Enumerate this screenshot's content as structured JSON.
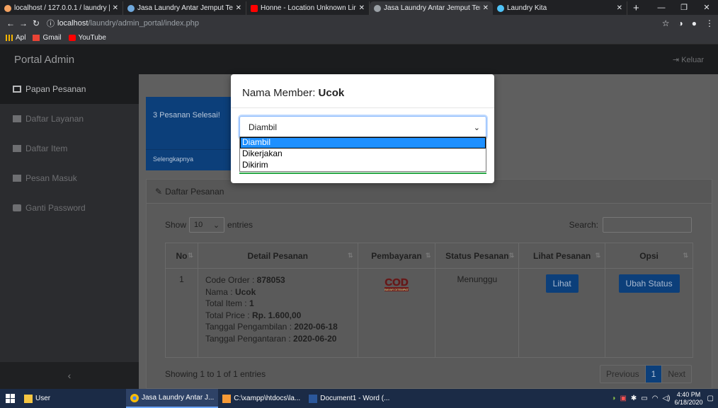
{
  "browser": {
    "tabs": [
      {
        "title": "localhost / 127.0.0.1 / laundry |",
        "icon": "phpmyadmin-icon",
        "color": "#f4a261"
      },
      {
        "title": "Jasa Laundry Antar Jemput Ter",
        "icon": "laundry-icon",
        "color": "#6fa8dc"
      },
      {
        "title": "Honne - Location Unknown Lir",
        "icon": "youtube-icon",
        "color": "#ff0000"
      },
      {
        "title": "Jasa Laundry Antar Jemput Ter",
        "icon": "globe-icon",
        "color": "#9aa0a6"
      },
      {
        "title": "Laundry Kita",
        "icon": "laundry-kita-icon",
        "color": "#4fc3f7"
      }
    ],
    "url_host": "localhost",
    "url_path": "/laundry/admin_portal/index.php",
    "bookmarks": [
      {
        "label": "Apl",
        "icon": "apps-icon"
      },
      {
        "label": "Gmail",
        "icon": "gmail-icon"
      },
      {
        "label": "YouTube",
        "icon": "youtube-icon"
      }
    ]
  },
  "app": {
    "brand": "Portal Admin",
    "logout": "Keluar",
    "sidebar": [
      {
        "label": "Papan Pesanan",
        "icon": "dashboard-icon"
      },
      {
        "label": "Daftar Layanan",
        "icon": "book-icon"
      },
      {
        "label": "Daftar Item",
        "icon": "bank-icon"
      },
      {
        "label": "Pesan Masuk",
        "icon": "envelope-icon"
      },
      {
        "label": "Ganti Password",
        "icon": "lock-icon"
      }
    ],
    "collapse": "‹",
    "stat_card": {
      "title": "3 Pesanan Selesai!",
      "footer": "Selengkapnya"
    },
    "panel_title": "Daftar Pesanan",
    "show_label": "Show",
    "entries_value": "10",
    "entries_label": "entries",
    "search_label": "Search:",
    "columns": [
      "No",
      "Detail Pesanan",
      "Pembayaran",
      "Status Pesanan",
      "Lihat Pesanan",
      "Opsi"
    ],
    "row": {
      "no": "1",
      "code_label": "Code Order : ",
      "code": "878053",
      "name_label": "Nama : ",
      "name": "Ucok",
      "items_label": "Total Item : ",
      "items": "1",
      "price_label": "Total Price : ",
      "price": "Rp. 1.600,00",
      "pickup_label": "Tanggal Pengambilan : ",
      "pickup": "2020-06-18",
      "delivery_label": "Tanggal Pengantaran : ",
      "delivery": "2020-06-20",
      "payment_logo": "COD",
      "payment_sub": "BAYAR DITEMPAT",
      "status": "Menunggu",
      "view_button": "Lihat",
      "action_button": "Ubah Status"
    },
    "showing": "Showing 1 to 1 of 1 entries",
    "pager": [
      "Previous",
      "1",
      "Next"
    ]
  },
  "modal": {
    "title_prefix": "Nama Member: ",
    "member": "Ucok",
    "selected": "Diambil",
    "options": [
      "Diambil",
      "Dikerjakan",
      "Dikirim"
    ]
  },
  "taskbar": {
    "items": [
      {
        "label": "User",
        "icon": "folder-icon"
      },
      {
        "label": "Jasa Laundry Antar J...",
        "icon": "chrome-icon"
      },
      {
        "label": "C:\\xampp\\htdocs\\la...",
        "icon": "sublime-icon"
      },
      {
        "label": "Document1 - Word (...",
        "icon": "word-icon"
      }
    ],
    "time": "4:40 PM",
    "date": "6/18/2020"
  }
}
